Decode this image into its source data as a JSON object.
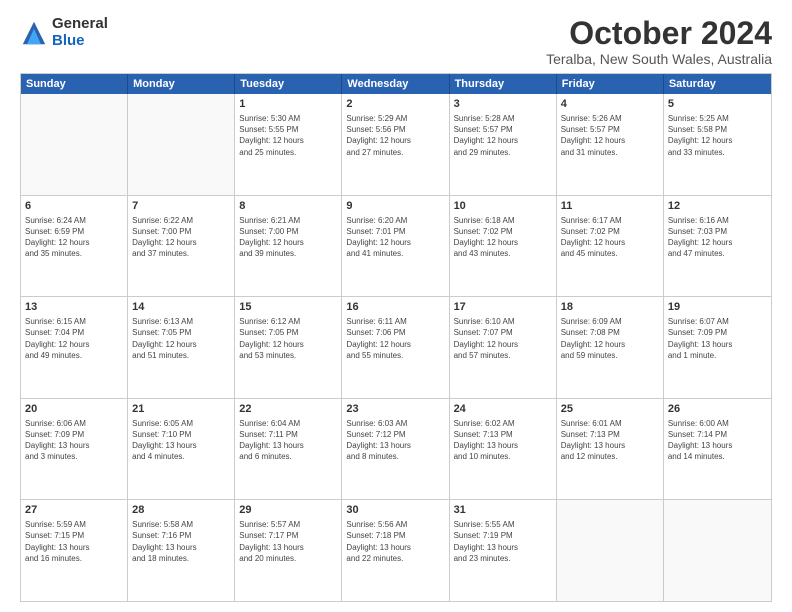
{
  "logo": {
    "general": "General",
    "blue": "Blue"
  },
  "title": "October 2024",
  "location": "Teralba, New South Wales, Australia",
  "days": [
    "Sunday",
    "Monday",
    "Tuesday",
    "Wednesday",
    "Thursday",
    "Friday",
    "Saturday"
  ],
  "rows": [
    [
      {
        "day": "",
        "info": ""
      },
      {
        "day": "",
        "info": ""
      },
      {
        "day": "1",
        "info": "Sunrise: 5:30 AM\nSunset: 5:55 PM\nDaylight: 12 hours\nand 25 minutes."
      },
      {
        "day": "2",
        "info": "Sunrise: 5:29 AM\nSunset: 5:56 PM\nDaylight: 12 hours\nand 27 minutes."
      },
      {
        "day": "3",
        "info": "Sunrise: 5:28 AM\nSunset: 5:57 PM\nDaylight: 12 hours\nand 29 minutes."
      },
      {
        "day": "4",
        "info": "Sunrise: 5:26 AM\nSunset: 5:57 PM\nDaylight: 12 hours\nand 31 minutes."
      },
      {
        "day": "5",
        "info": "Sunrise: 5:25 AM\nSunset: 5:58 PM\nDaylight: 12 hours\nand 33 minutes."
      }
    ],
    [
      {
        "day": "6",
        "info": "Sunrise: 6:24 AM\nSunset: 6:59 PM\nDaylight: 12 hours\nand 35 minutes."
      },
      {
        "day": "7",
        "info": "Sunrise: 6:22 AM\nSunset: 7:00 PM\nDaylight: 12 hours\nand 37 minutes."
      },
      {
        "day": "8",
        "info": "Sunrise: 6:21 AM\nSunset: 7:00 PM\nDaylight: 12 hours\nand 39 minutes."
      },
      {
        "day": "9",
        "info": "Sunrise: 6:20 AM\nSunset: 7:01 PM\nDaylight: 12 hours\nand 41 minutes."
      },
      {
        "day": "10",
        "info": "Sunrise: 6:18 AM\nSunset: 7:02 PM\nDaylight: 12 hours\nand 43 minutes."
      },
      {
        "day": "11",
        "info": "Sunrise: 6:17 AM\nSunset: 7:02 PM\nDaylight: 12 hours\nand 45 minutes."
      },
      {
        "day": "12",
        "info": "Sunrise: 6:16 AM\nSunset: 7:03 PM\nDaylight: 12 hours\nand 47 minutes."
      }
    ],
    [
      {
        "day": "13",
        "info": "Sunrise: 6:15 AM\nSunset: 7:04 PM\nDaylight: 12 hours\nand 49 minutes."
      },
      {
        "day": "14",
        "info": "Sunrise: 6:13 AM\nSunset: 7:05 PM\nDaylight: 12 hours\nand 51 minutes."
      },
      {
        "day": "15",
        "info": "Sunrise: 6:12 AM\nSunset: 7:05 PM\nDaylight: 12 hours\nand 53 minutes."
      },
      {
        "day": "16",
        "info": "Sunrise: 6:11 AM\nSunset: 7:06 PM\nDaylight: 12 hours\nand 55 minutes."
      },
      {
        "day": "17",
        "info": "Sunrise: 6:10 AM\nSunset: 7:07 PM\nDaylight: 12 hours\nand 57 minutes."
      },
      {
        "day": "18",
        "info": "Sunrise: 6:09 AM\nSunset: 7:08 PM\nDaylight: 12 hours\nand 59 minutes."
      },
      {
        "day": "19",
        "info": "Sunrise: 6:07 AM\nSunset: 7:09 PM\nDaylight: 13 hours\nand 1 minute."
      }
    ],
    [
      {
        "day": "20",
        "info": "Sunrise: 6:06 AM\nSunset: 7:09 PM\nDaylight: 13 hours\nand 3 minutes."
      },
      {
        "day": "21",
        "info": "Sunrise: 6:05 AM\nSunset: 7:10 PM\nDaylight: 13 hours\nand 4 minutes."
      },
      {
        "day": "22",
        "info": "Sunrise: 6:04 AM\nSunset: 7:11 PM\nDaylight: 13 hours\nand 6 minutes."
      },
      {
        "day": "23",
        "info": "Sunrise: 6:03 AM\nSunset: 7:12 PM\nDaylight: 13 hours\nand 8 minutes."
      },
      {
        "day": "24",
        "info": "Sunrise: 6:02 AM\nSunset: 7:13 PM\nDaylight: 13 hours\nand 10 minutes."
      },
      {
        "day": "25",
        "info": "Sunrise: 6:01 AM\nSunset: 7:13 PM\nDaylight: 13 hours\nand 12 minutes."
      },
      {
        "day": "26",
        "info": "Sunrise: 6:00 AM\nSunset: 7:14 PM\nDaylight: 13 hours\nand 14 minutes."
      }
    ],
    [
      {
        "day": "27",
        "info": "Sunrise: 5:59 AM\nSunset: 7:15 PM\nDaylight: 13 hours\nand 16 minutes."
      },
      {
        "day": "28",
        "info": "Sunrise: 5:58 AM\nSunset: 7:16 PM\nDaylight: 13 hours\nand 18 minutes."
      },
      {
        "day": "29",
        "info": "Sunrise: 5:57 AM\nSunset: 7:17 PM\nDaylight: 13 hours\nand 20 minutes."
      },
      {
        "day": "30",
        "info": "Sunrise: 5:56 AM\nSunset: 7:18 PM\nDaylight: 13 hours\nand 22 minutes."
      },
      {
        "day": "31",
        "info": "Sunrise: 5:55 AM\nSunset: 7:19 PM\nDaylight: 13 hours\nand 23 minutes."
      },
      {
        "day": "",
        "info": ""
      },
      {
        "day": "",
        "info": ""
      }
    ]
  ]
}
